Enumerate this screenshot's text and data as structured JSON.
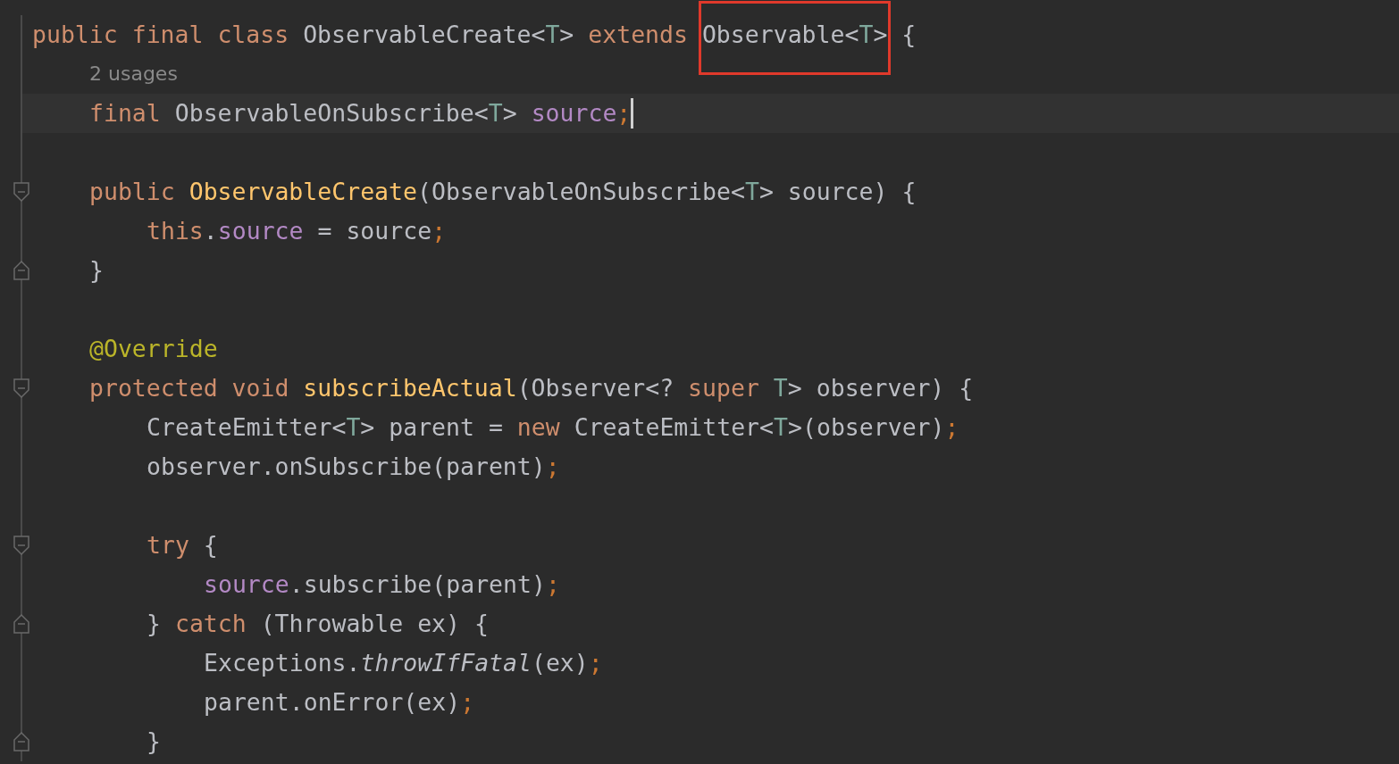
{
  "lines": [
    {
      "kind": "code",
      "tokens": [
        {
          "text": "public final class ",
          "kind": "k"
        },
        {
          "text": "ObservableCreate<",
          "kind": "p"
        },
        {
          "text": "T",
          "kind": "t"
        },
        {
          "text": "> ",
          "kind": "p"
        },
        {
          "text": "extends ",
          "kind": "k"
        },
        {
          "text": "Observable<",
          "kind": "p",
          "boxed": true
        },
        {
          "text": "T",
          "kind": "t",
          "boxed": true
        },
        {
          "text": ">",
          "kind": "p",
          "boxed": true
        },
        {
          "text": " {",
          "kind": "p"
        }
      ],
      "children": [
        {
          "kind": "hint",
          "text": "2 usages"
        },
        {
          "kind": "code",
          "current": true,
          "caret": true,
          "tokens": [
            {
              "text": "final ",
              "kind": "k"
            },
            {
              "text": "ObservableOnSubscribe<",
              "kind": "p"
            },
            {
              "text": "T",
              "kind": "t"
            },
            {
              "text": "> ",
              "kind": "p"
            },
            {
              "text": "source",
              "kind": "f"
            },
            {
              "text": ";",
              "kind": "s"
            }
          ]
        },
        {
          "kind": "blank"
        },
        {
          "kind": "code",
          "fold_start": true,
          "tokens": [
            {
              "text": "public ",
              "kind": "k"
            },
            {
              "text": "ObservableCreate",
              "kind": "m"
            },
            {
              "text": "(ObservableOnSubscribe<",
              "kind": "p"
            },
            {
              "text": "T",
              "kind": "t"
            },
            {
              "text": "> source) {",
              "kind": "p"
            }
          ],
          "children": [
            {
              "kind": "code",
              "tokens": [
                {
                  "text": "this",
                  "kind": "k"
                },
                {
                  "text": ".",
                  "kind": "p"
                },
                {
                  "text": "source",
                  "kind": "f"
                },
                {
                  "text": " = source",
                  "kind": "p"
                },
                {
                  "text": ";",
                  "kind": "s"
                }
              ]
            }
          ]
        },
        {
          "kind": "code",
          "fold_end": true,
          "tokens": [
            {
              "text": "}",
              "kind": "p"
            }
          ]
        },
        {
          "kind": "blank"
        },
        {
          "kind": "code",
          "tokens": [
            {
              "text": "@Override",
              "kind": "a"
            }
          ]
        },
        {
          "kind": "code",
          "fold_start": true,
          "tokens": [
            {
              "text": "protected void ",
              "kind": "k"
            },
            {
              "text": "subscribeActual",
              "kind": "m"
            },
            {
              "text": "(Observer<? ",
              "kind": "p"
            },
            {
              "text": "super ",
              "kind": "k"
            },
            {
              "text": "T",
              "kind": "t"
            },
            {
              "text": "> observer) {",
              "kind": "p"
            }
          ],
          "children": [
            {
              "kind": "code",
              "tokens": [
                {
                  "text": "CreateEmitter<",
                  "kind": "p"
                },
                {
                  "text": "T",
                  "kind": "t"
                },
                {
                  "text": "> parent = ",
                  "kind": "p"
                },
                {
                  "text": "new ",
                  "kind": "k"
                },
                {
                  "text": "CreateEmitter<",
                  "kind": "p"
                },
                {
                  "text": "T",
                  "kind": "t"
                },
                {
                  "text": ">(observer)",
                  "kind": "p"
                },
                {
                  "text": ";",
                  "kind": "s"
                }
              ]
            },
            {
              "kind": "code",
              "tokens": [
                {
                  "text": "observer.onSubscribe(parent)",
                  "kind": "p"
                },
                {
                  "text": ";",
                  "kind": "s"
                }
              ]
            },
            {
              "kind": "blank"
            },
            {
              "kind": "code",
              "fold_start": true,
              "tokens": [
                {
                  "text": "try ",
                  "kind": "k"
                },
                {
                  "text": "{",
                  "kind": "p"
                }
              ],
              "children": [
                {
                  "kind": "code",
                  "tokens": [
                    {
                      "text": "source",
                      "kind": "f"
                    },
                    {
                      "text": ".subscribe(parent)",
                      "kind": "p"
                    },
                    {
                      "text": ";",
                      "kind": "s"
                    }
                  ]
                }
              ]
            },
            {
              "kind": "code",
              "fold_end": true,
              "tokens": [
                {
                  "text": "} ",
                  "kind": "p"
                },
                {
                  "text": "catch ",
                  "kind": "k"
                },
                {
                  "text": "(Throwable ex) {",
                  "kind": "p"
                }
              ],
              "children": [
                {
                  "kind": "code",
                  "tokens": [
                    {
                      "text": "Exceptions.",
                      "kind": "p"
                    },
                    {
                      "text": "throwIfFatal",
                      "kind": "i"
                    },
                    {
                      "text": "(ex)",
                      "kind": "p"
                    },
                    {
                      "text": ";",
                      "kind": "s"
                    }
                  ]
                },
                {
                  "kind": "code",
                  "tokens": [
                    {
                      "text": "parent.onError(ex)",
                      "kind": "p"
                    },
                    {
                      "text": ";",
                      "kind": "s"
                    }
                  ]
                }
              ]
            },
            {
              "kind": "code",
              "fold_end": true,
              "tokens": [
                {
                  "text": "}",
                  "kind": "p"
                }
              ]
            }
          ]
        }
      ]
    }
  ]
}
